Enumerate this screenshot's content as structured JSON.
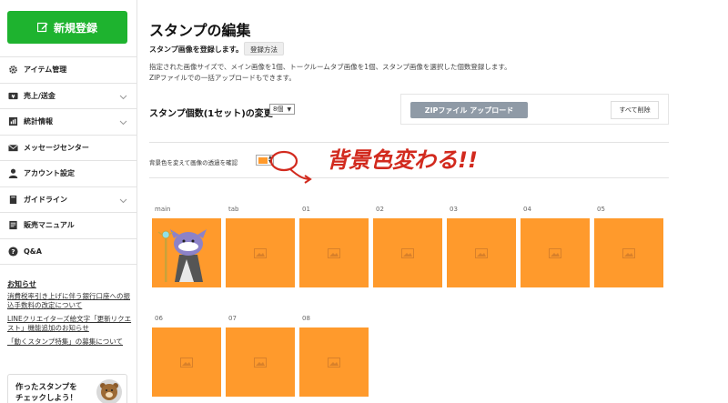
{
  "sidebar": {
    "new_button": "新規登録",
    "accent_color": "#1eb32f",
    "items": [
      {
        "label": "アイテム管理",
        "icon": "gear-icon",
        "chevron": false
      },
      {
        "label": "売上/送金",
        "icon": "yen-icon",
        "chevron": true
      },
      {
        "label": "統計情報",
        "icon": "chart-icon",
        "chevron": true
      },
      {
        "label": "メッセージセンター",
        "icon": "mail-icon",
        "chevron": false
      },
      {
        "label": "アカウント設定",
        "icon": "person-icon",
        "chevron": false
      },
      {
        "label": "ガイドライン",
        "icon": "book-icon",
        "chevron": true
      },
      {
        "label": "販売マニュアル",
        "icon": "manual-icon",
        "chevron": false
      },
      {
        "label": "Q&A",
        "icon": "question-icon",
        "chevron": false
      }
    ],
    "notice_title": "お知らせ",
    "notices": [
      "消費税率引き上げに伴う銀行口座への振込手数料の改定について",
      "LINEクリエイターズ絵文字「更新リクエスト」機能追加のお知らせ",
      "「動くスタンプ特集」の募集について"
    ],
    "promo_text": "作ったスタンプを\nチェックしよう！"
  },
  "main": {
    "title": "スタンプの編集",
    "register_line": "スタンプ画像を登録します。",
    "how_button": "登録方法",
    "desc1": "指定された画像サイズで、メイン画像を1個、トークルームタブ画像を1個、スタンプ画像を選択した個数登録します。",
    "desc2": "ZIPファイルでの一括アップロードもできます。",
    "count_label": "スタンプ個数(1セット)の変更",
    "count_value": "8個",
    "zip_button": "ZIPファイル アップロード",
    "delete_all": "すべて削除",
    "bg_label": "背景色を変えて画像の透過を確認",
    "bg_color": "#ff9a2c",
    "annotation": "背景色変わる!!",
    "annotation_color": "#d22a1e",
    "slots": [
      {
        "label": "main",
        "image": "character"
      },
      {
        "label": "tab",
        "image": "placeholder"
      },
      {
        "label": "01",
        "image": "placeholder"
      },
      {
        "label": "02",
        "image": "placeholder"
      },
      {
        "label": "03",
        "image": "placeholder"
      },
      {
        "label": "04",
        "image": "placeholder"
      },
      {
        "label": "05",
        "image": "placeholder"
      },
      {
        "label": "06",
        "image": "placeholder"
      },
      {
        "label": "07",
        "image": "placeholder"
      },
      {
        "label": "08",
        "image": "placeholder"
      }
    ]
  }
}
